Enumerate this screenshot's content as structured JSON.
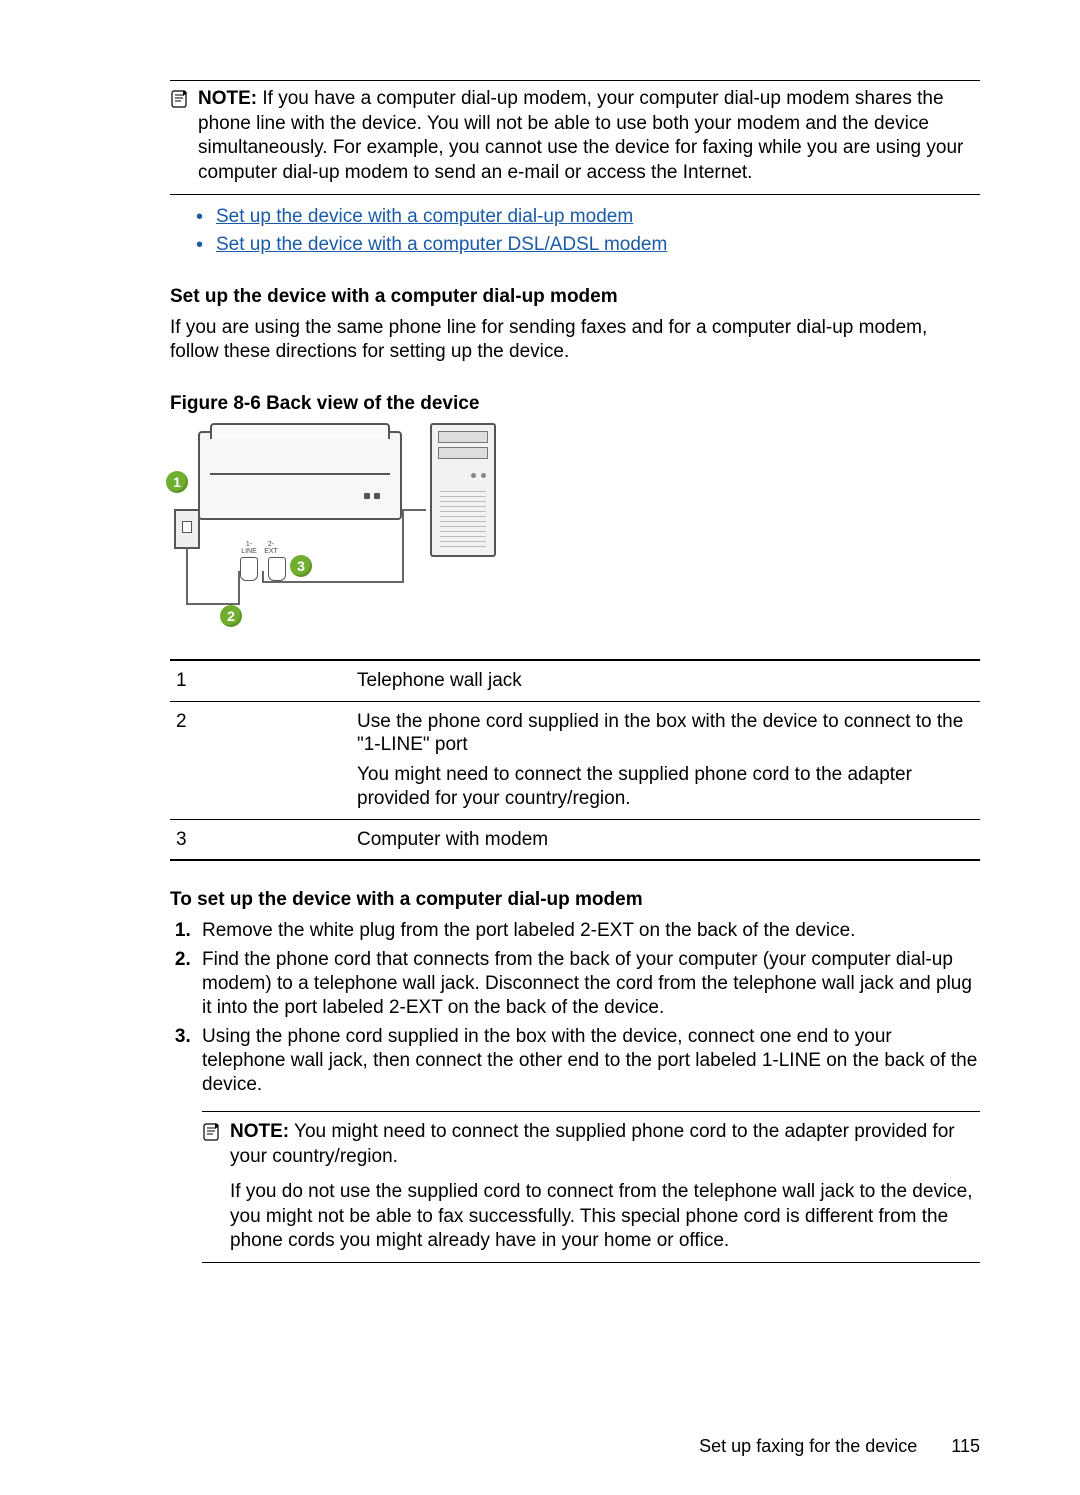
{
  "note1": {
    "label": "NOTE:",
    "text": "If you have a computer dial-up modem, your computer dial-up modem shares the phone line with the device. You will not be able to use both your modem and the device simultaneously. For example, you cannot use the device for faxing while you are using your computer dial-up modem to send an e-mail or access the Internet."
  },
  "links": [
    "Set up the device with a computer dial-up modem",
    "Set up the device with a computer DSL/ADSL modem"
  ],
  "section_heading": "Set up the device with a computer dial-up modem",
  "section_intro": "If you are using the same phone line for sending faxes and for a computer dial-up modem, follow these directions for setting up the device.",
  "figure_caption": "Figure 8-6 Back view of the device",
  "callouts": {
    "c1": "1",
    "c2": "2",
    "c3": "3"
  },
  "table": [
    {
      "num": "1",
      "desc": [
        "Telephone wall jack"
      ]
    },
    {
      "num": "2",
      "desc": [
        "Use the phone cord supplied in the box with the device to connect to the \"1-LINE\" port",
        "You might need to connect the supplied phone cord to the adapter provided for your country/region."
      ]
    },
    {
      "num": "3",
      "desc": [
        "Computer with modem"
      ]
    }
  ],
  "procedure_heading": "To set up the device with a computer dial-up modem",
  "steps": [
    "Remove the white plug from the port labeled 2-EXT on the back of the device.",
    "Find the phone cord that connects from the back of your computer (your computer dial-up modem) to a telephone wall jack. Disconnect the cord from the telephone wall jack and plug it into the port labeled 2-EXT on the back of the device.",
    "Using the phone cord supplied in the box with the device, connect one end to your telephone wall jack, then connect the other end to the port labeled 1-LINE on the back of the device."
  ],
  "sub_note": {
    "label": "NOTE:",
    "p1": "You might need to connect the supplied phone cord to the adapter provided for your country/region.",
    "p2": "If you do not use the supplied cord to connect from the telephone wall jack to the device, you might not be able to fax successfully. This special phone cord is different from the phone cords you might already have in your home or office."
  },
  "footer": {
    "section": "Set up faxing for the device",
    "page": "115"
  }
}
